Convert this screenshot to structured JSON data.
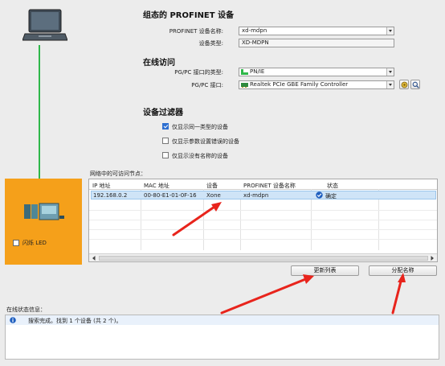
{
  "left": {
    "blink_led_label": "闪烁 LED"
  },
  "profinet": {
    "heading": "组态的 PROFINET 设备",
    "device_name_label": "PROFINET 设备名称:",
    "device_name_value": "xd-mdpn",
    "device_type_label": "设备类型:",
    "device_type_value": "XD-MDPN"
  },
  "online": {
    "heading": "在线访问",
    "interface_type_label": "PG/PC 接口的类型:",
    "interface_type_value": "PN/IE",
    "interface_label": "PG/PC 接口:",
    "interface_value": "Realtek PCIe GBE Family Controller"
  },
  "filter": {
    "heading": "设备过滤器",
    "options": [
      {
        "label": "仅显示同一类型的设备",
        "checked": true
      },
      {
        "label": "仅显示参数设置错误的设备",
        "checked": false
      },
      {
        "label": "仅显示没有名称的设备",
        "checked": false
      }
    ]
  },
  "nodes": {
    "caption": "网络中的可访问节点：",
    "columns": [
      "IP 地址",
      "MAC 地址",
      "设备",
      "PROFINET 设备名称",
      "状态"
    ],
    "rows": [
      {
        "ip": "192.168.0.2",
        "mac": "00-80-E1-01-0F-16",
        "device": "Xone",
        "name": "xd-mdpn",
        "status": "确定"
      }
    ]
  },
  "buttons": {
    "refresh": "更新列表",
    "assign": "分配名称"
  },
  "status": {
    "heading": "在线状态信息：",
    "message": "搜索完成。找到 1 个设备 (共 2 个)。"
  },
  "colors": {
    "orange_panel": "#f5a01a",
    "green_link": "#2fb84a",
    "arrow_red": "#e8241c",
    "selection": "#cfe4f7"
  }
}
